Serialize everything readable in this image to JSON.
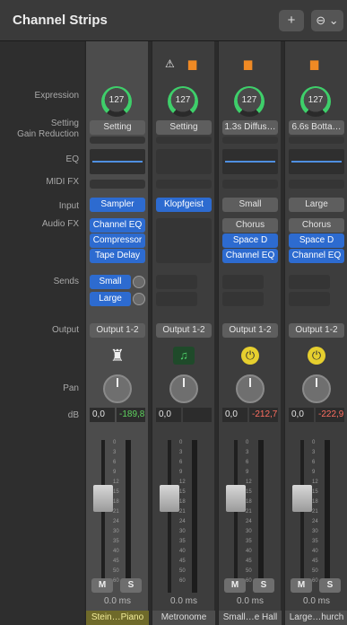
{
  "header": {
    "title": "Channel Strips",
    "add_label": "+",
    "more_label": "⊖ ⌄"
  },
  "labels": {
    "expression": "Expression",
    "setting": "Setting",
    "gain_reduction": "Gain Reduction",
    "eq": "EQ",
    "midi_fx": "MIDI FX",
    "input": "Input",
    "audio_fx": "Audio FX",
    "sends": "Sends",
    "output": "Output",
    "pan": "Pan",
    "db": "dB"
  },
  "strips": [
    {
      "expression": "127",
      "setting": "Setting",
      "input": "Sampler",
      "audio_fx": [
        "Channel EQ",
        "Compressor",
        "Tape Delay"
      ],
      "sends": [
        "Small",
        "Large"
      ],
      "output": "Output 1-2",
      "db_value": "0,0",
      "db_peak": "-189,8",
      "mute": "M",
      "solo": "S",
      "latency": "0.0 ms",
      "name": "Stein…Piano",
      "name_color": "#e8e06a",
      "icon": "piano-icon"
    },
    {
      "expression": "127",
      "setting": "Setting",
      "input": "Klopfgeist",
      "audio_fx": [],
      "sends": [],
      "output": "Output 1-2",
      "db_value": "0,0",
      "db_peak": "",
      "mute": "",
      "solo": "",
      "latency": "0.0 ms",
      "name": "Metronome",
      "name_color": "#cfcfcf",
      "icon": "music-note-icon"
    },
    {
      "expression": "127",
      "setting": "1.3s Diffus…",
      "input": "Small",
      "audio_fx": [
        "Chorus",
        "Space D",
        "Channel EQ"
      ],
      "sends": [],
      "output": "Output 1-2",
      "db_value": "0,0",
      "db_peak": "-212,7",
      "mute": "M",
      "solo": "S",
      "latency": "0.0 ms",
      "name": "Small…e Hall",
      "name_color": "#cfcfcf",
      "icon": "power-icon"
    },
    {
      "expression": "127",
      "setting": "6.6s Botta…",
      "input": "Large",
      "audio_fx": [
        "Chorus",
        "Space D",
        "Channel EQ"
      ],
      "sends": [],
      "output": "Output 1-2",
      "db_value": "0,0",
      "db_peak": "-222,9",
      "mute": "M",
      "solo": "S",
      "latency": "0.0 ms",
      "name": "Large…hurch",
      "name_color": "#cfcfcf",
      "icon": "power-icon"
    }
  ],
  "scale_labels": [
    "0",
    "3",
    "6",
    "9",
    "12",
    "15",
    "18",
    "21",
    "24",
    "30",
    "35",
    "40",
    "45",
    "50",
    "60"
  ]
}
